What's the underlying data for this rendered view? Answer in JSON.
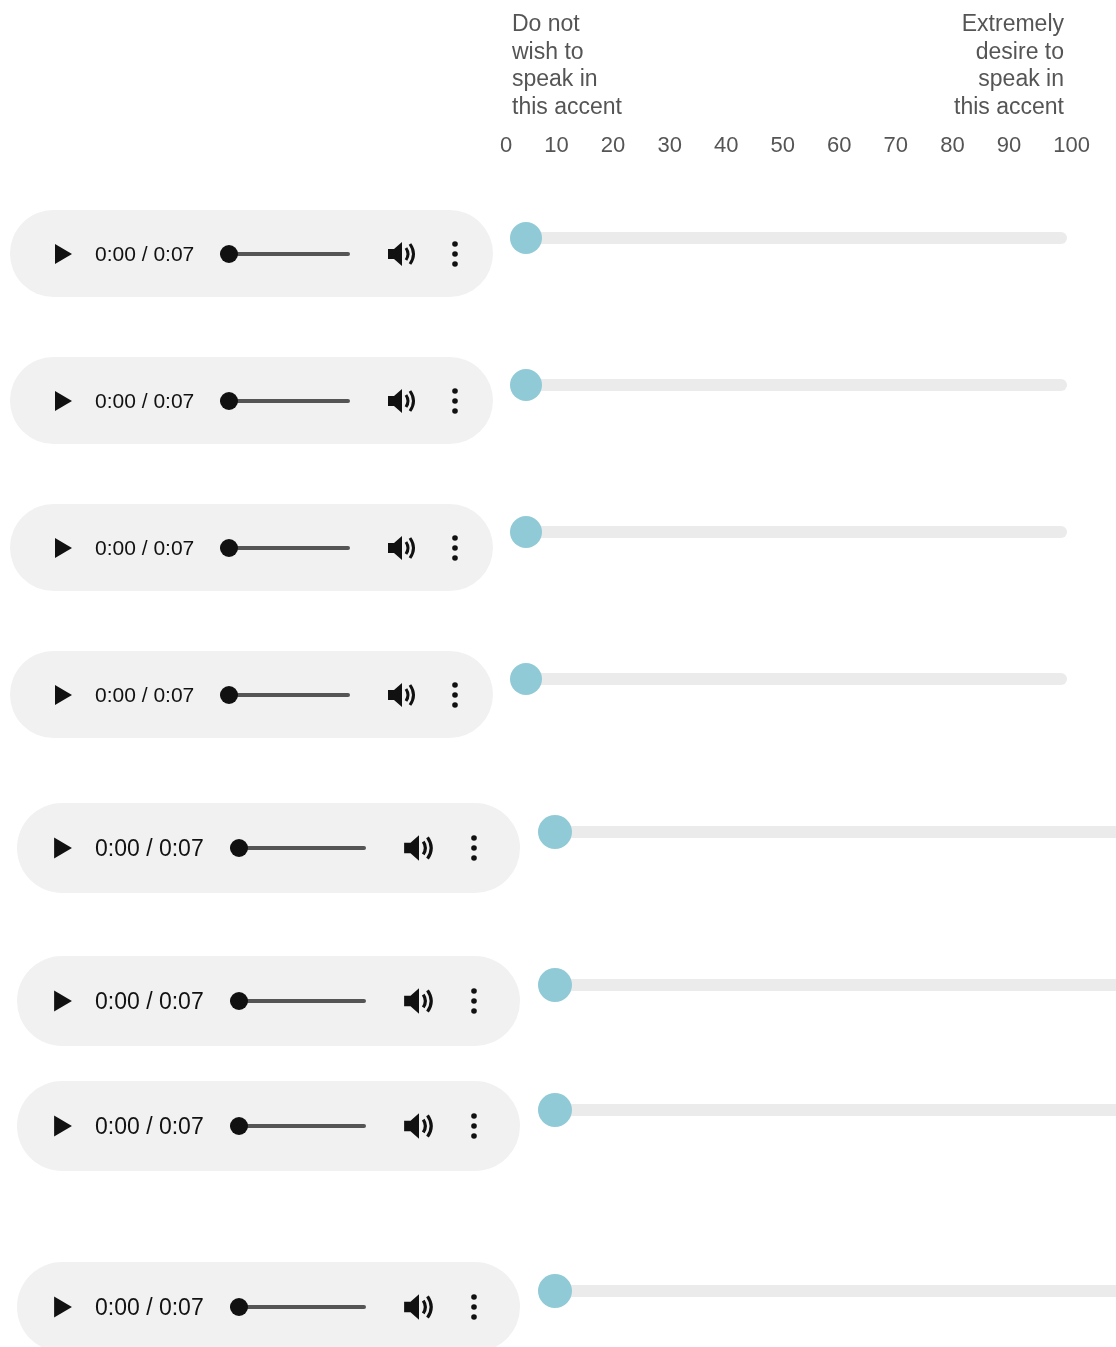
{
  "scale": {
    "left_label": "Do not wish to speak in this accent",
    "right_label": "Extremely desire to speak in this accent",
    "ticks": [
      "0",
      "10",
      "20",
      "30",
      "40",
      "50",
      "60",
      "70",
      "80",
      "90",
      "100"
    ]
  },
  "rows": [
    {
      "player": {
        "time": "0:00 / 0:07",
        "level": 0
      },
      "rating": {
        "level": 0
      }
    },
    {
      "player": {
        "time": "0:00 / 0:07",
        "level": 0
      },
      "rating": {
        "level": 0
      }
    },
    {
      "player": {
        "time": "0:00 / 0:07",
        "level": 0
      },
      "rating": {
        "level": 0
      }
    },
    {
      "player": {
        "time": "0:00 / 0:07",
        "level": 0
      },
      "rating": {
        "level": 0
      }
    },
    {
      "player": {
        "time": "0:00 / 0:07",
        "level": 0
      },
      "rating": {
        "level": 0
      }
    },
    {
      "player": {
        "time": "0:00 / 0:07",
        "level": 0
      },
      "rating": {
        "level": 0
      }
    },
    {
      "player": {
        "time": "0:00 / 0:07",
        "level": 0
      },
      "rating": {
        "level": 0
      }
    },
    {
      "player": {
        "time": "0:00 / 0:07",
        "level": 0
      },
      "rating": {
        "level": 0
      }
    }
  ]
}
